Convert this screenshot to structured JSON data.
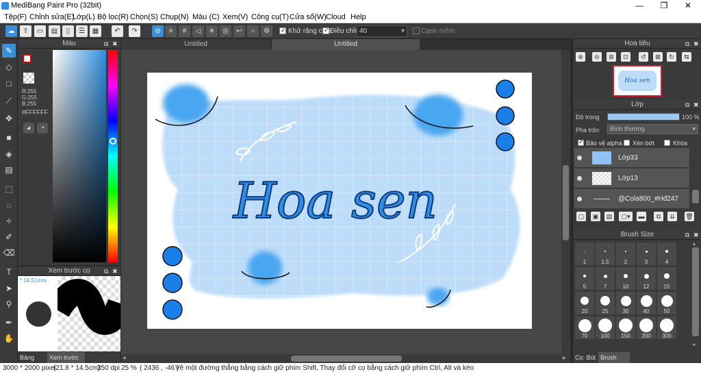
{
  "app": {
    "title": "MediBang Paint Pro (32bit)",
    "minimize": "—",
    "maximize": "❐",
    "close": "✕"
  },
  "menu": [
    "Tệp(F)",
    "Chỉnh sửa(E)",
    "Lớp(L)",
    "Bộ lọc(R)",
    "Chọn(S)",
    "Chụp(N)",
    "Màu (C)",
    "Xem(V)",
    "Công cụ(T)",
    "Cửa sổ(W)",
    "Cloud",
    "Help"
  ],
  "toolbar": {
    "antialias_label": "Khử răng cưa",
    "adjust_label": "Điều chỉnh",
    "adjust_value": "40",
    "edge_label": "Cạnh mềm"
  },
  "color_panel": {
    "title": "Màu",
    "r": "R:255",
    "g": "G:255",
    "b": "B:255",
    "hex": "#FFFFFF"
  },
  "preview_panel": {
    "title": "Xem trước cọ",
    "size": "14.51mm",
    "tab_palette": "Bảng màu",
    "tab_preview": "Xem trước cọ"
  },
  "tabs": [
    "Untitled",
    "Untitled"
  ],
  "artwork": {
    "title_text": "Hoa sen"
  },
  "navigator": {
    "title": "Hoa tiêu",
    "thumb_text": "Hoa sen"
  },
  "layers": {
    "title": "Lớp",
    "opacity_label": "Độ trong",
    "opacity_value": "100 %",
    "opacity_fraction": 1.0,
    "blend_label": "Pha trộn",
    "blend_value": "Bình thường",
    "protect_alpha": "Bảo vệ alpha",
    "clipping": "Xén bớt",
    "lock": "Khóa",
    "items": [
      {
        "name": "Lớp33",
        "thumb": "blue"
      },
      {
        "name": "Lớp13",
        "thumb": "checker"
      },
      {
        "name": "@Cola800_#Hđ247",
        "thumb": "line"
      }
    ]
  },
  "brush_size": {
    "title": "Brush Size",
    "sizes": [
      "1",
      "1.5",
      "2",
      "3",
      "4",
      "5",
      "7",
      "10",
      "12",
      "15",
      "20",
      "25",
      "30",
      "40",
      "50",
      "70",
      "100",
      "150",
      "200",
      "300"
    ],
    "tab_brush": "Cọ: Bút",
    "tab_size": "Brush Size"
  },
  "status": {
    "dimensions": "3000 * 2000 pixel",
    "size_cm": "(21.8 * 14.5cm)",
    "dpi": "350 dpi",
    "zoom": "25 %",
    "coords": "( 2436 , -46 )",
    "hint": "Vẽ một đường thẳng bằng cách giữ phím Shift, Thay đổi cỡ cọ bằng cách giữ phím Ctrl, Alt và kéo"
  }
}
